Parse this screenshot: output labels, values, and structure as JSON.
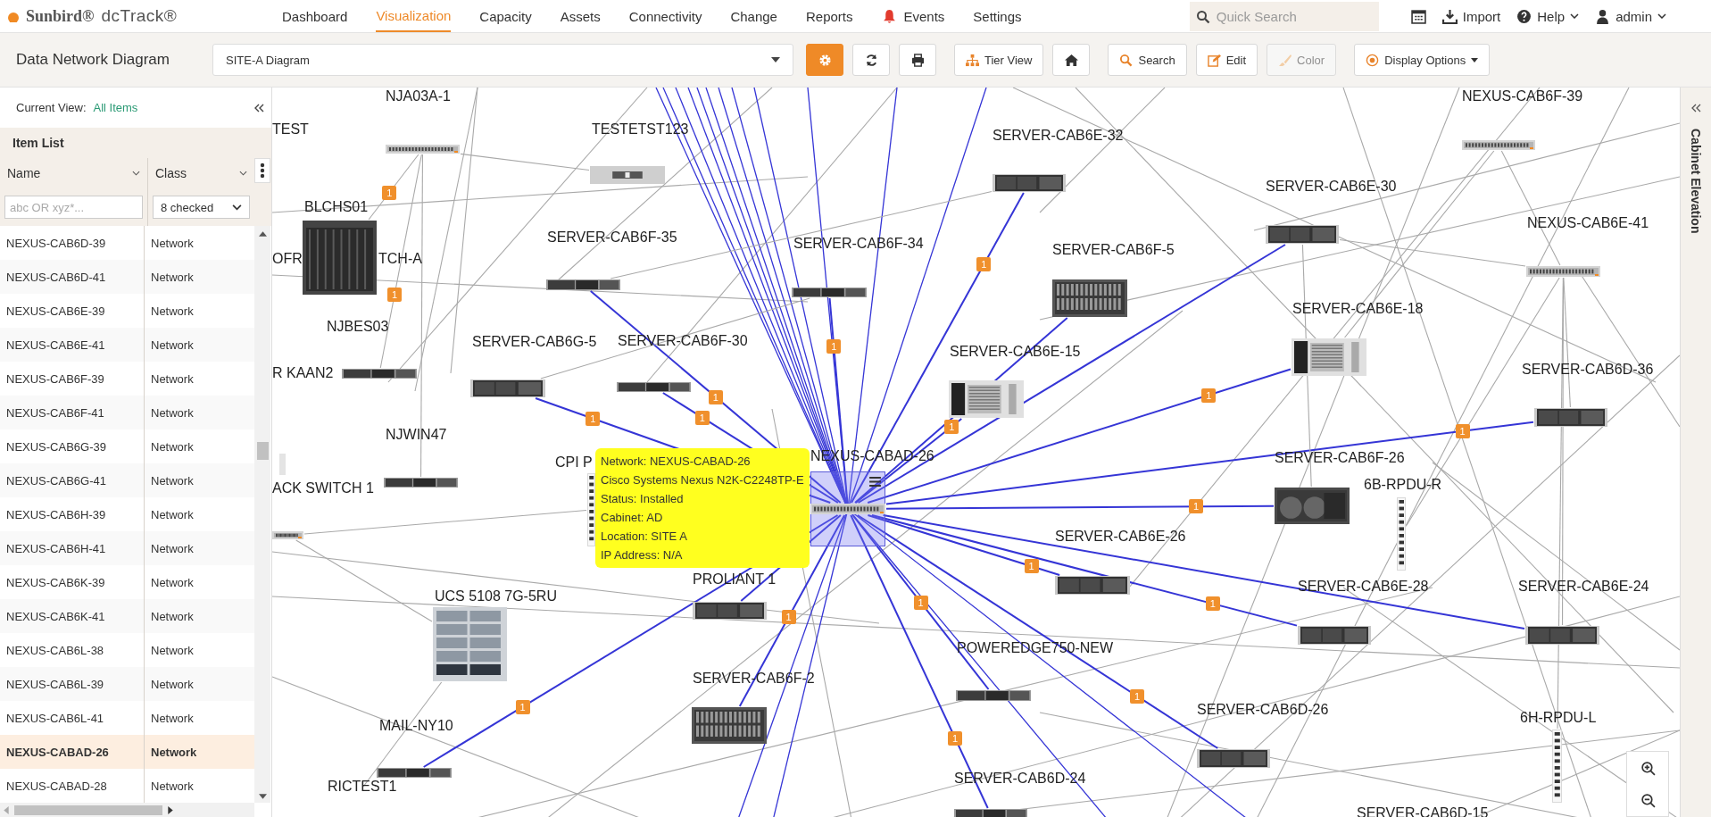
{
  "header": {
    "brand": "Sunbird®",
    "product": "dcTrack®",
    "nav": [
      {
        "label": "Dashboard",
        "kind": "plain",
        "selected": false
      },
      {
        "label": "Visualization",
        "kind": "plain",
        "selected": true
      },
      {
        "label": "Capacity",
        "kind": "plain",
        "selected": false
      },
      {
        "label": "Assets",
        "kind": "plain",
        "selected": false
      },
      {
        "label": "Connectivity",
        "kind": "plain",
        "selected": false
      },
      {
        "label": "Change",
        "kind": "plain",
        "selected": false
      },
      {
        "label": "Reports",
        "kind": "plain",
        "selected": false
      },
      {
        "label": "Events",
        "kind": "alert",
        "selected": false
      },
      {
        "label": "Settings",
        "kind": "plain",
        "selected": false
      }
    ],
    "search": {
      "placeholder": "Quick Search"
    },
    "actions": [
      {
        "kind": "calendar"
      },
      {
        "kind": "import",
        "label": "Import"
      },
      {
        "kind": "help",
        "label": "Help",
        "menu": true
      },
      {
        "kind": "user",
        "label": "admin",
        "menu": true
      }
    ]
  },
  "toolbar": {
    "title": "Data Network Diagram",
    "diagram_select": "SITE-A Diagram",
    "buttons": [
      {
        "kind": "settings",
        "active": true,
        "disabled": false
      },
      {
        "kind": "refresh",
        "active": false,
        "disabled": false
      },
      {
        "kind": "print",
        "active": false,
        "disabled": false
      },
      {
        "kind": "tier",
        "label": "Tier View",
        "active": false,
        "disabled": false
      },
      {
        "kind": "home",
        "active": false,
        "disabled": false
      },
      {
        "kind": "search",
        "label": "Search",
        "active": false,
        "disabled": false
      },
      {
        "kind": "edit",
        "label": "Edit",
        "active": false,
        "disabled": false
      },
      {
        "kind": "color",
        "label": "Color",
        "active": false,
        "disabled": true
      },
      {
        "kind": "display",
        "label": "Display Options",
        "menu": true,
        "active": false,
        "disabled": false
      }
    ]
  },
  "item_panel": {
    "current_view_label": "Current View:",
    "current_view": "All Items",
    "title": "Item List",
    "columns": [
      "Name",
      "Class"
    ],
    "name_filter_placeholder": "abc OR xyz*...",
    "class_filter": "8 checked",
    "rows": [
      {
        "name": "NEXUS-CAB6D-39",
        "class": "Network",
        "selected": false
      },
      {
        "name": "NEXUS-CAB6D-41",
        "class": "Network",
        "selected": false
      },
      {
        "name": "NEXUS-CAB6E-39",
        "class": "Network",
        "selected": false
      },
      {
        "name": "NEXUS-CAB6E-41",
        "class": "Network",
        "selected": false
      },
      {
        "name": "NEXUS-CAB6F-39",
        "class": "Network",
        "selected": false
      },
      {
        "name": "NEXUS-CAB6F-41",
        "class": "Network",
        "selected": false
      },
      {
        "name": "NEXUS-CAB6G-39",
        "class": "Network",
        "selected": false
      },
      {
        "name": "NEXUS-CAB6G-41",
        "class": "Network",
        "selected": false
      },
      {
        "name": "NEXUS-CAB6H-39",
        "class": "Network",
        "selected": false
      },
      {
        "name": "NEXUS-CAB6H-41",
        "class": "Network",
        "selected": false
      },
      {
        "name": "NEXUS-CAB6K-39",
        "class": "Network",
        "selected": false
      },
      {
        "name": "NEXUS-CAB6K-41",
        "class": "Network",
        "selected": false
      },
      {
        "name": "NEXUS-CAB6L-38",
        "class": "Network",
        "selected": false
      },
      {
        "name": "NEXUS-CAB6L-39",
        "class": "Network",
        "selected": false
      },
      {
        "name": "NEXUS-CAB6L-41",
        "class": "Network",
        "selected": false
      },
      {
        "name": "NEXUS-CABAD-26",
        "class": "Network",
        "selected": true
      },
      {
        "name": "NEXUS-CABAD-28",
        "class": "Network",
        "selected": false
      }
    ]
  },
  "diagram": {
    "nodes": [
      {
        "label": "NJA03A-1",
        "kind": "switch",
        "selected": false
      },
      {
        "label": "TEST",
        "kind": "label",
        "selected": false
      },
      {
        "label": "TESTETST123",
        "kind": "server-light",
        "selected": false
      },
      {
        "label": "BLCHS01",
        "kind": "chassis",
        "selected": false
      },
      {
        "label": "OFR",
        "kind": "label",
        "selected": false
      },
      {
        "label": "TCH-A",
        "kind": "label",
        "selected": false
      },
      {
        "label": "SERVER-CAB6F-35",
        "kind": "server1u",
        "selected": false
      },
      {
        "label": "SERVER-CAB6F-34",
        "kind": "server1u",
        "selected": false
      },
      {
        "label": "NJBES03",
        "kind": "label",
        "selected": false
      },
      {
        "label": "SERVER-CAB6G-5",
        "kind": "server2u",
        "selected": false
      },
      {
        "label": "SERVER-CAB6F-30",
        "kind": "server1u",
        "selected": false
      },
      {
        "label": "R KAAN2",
        "kind": "server1u",
        "selected": false
      },
      {
        "label": "NJWIN47",
        "kind": "server1u",
        "selected": false
      },
      {
        "label": "CPI P",
        "kind": "pdu",
        "selected": false
      },
      {
        "label": "ACK SWITCH 1",
        "kind": "switch",
        "selected": false
      },
      {
        "label": "NEXUS-CABAD-26",
        "kind": "switch",
        "selected": true
      },
      {
        "label": "PROLIANT 1",
        "kind": "server2u",
        "selected": false
      },
      {
        "label": "UCS 5108 7G-5RU",
        "kind": "ucs",
        "selected": false
      },
      {
        "label": "SERVER-CAB6F-2",
        "kind": "blade",
        "selected": false
      },
      {
        "label": "MAIL-NY10",
        "kind": "server1u",
        "selected": false
      },
      {
        "label": "RICTEST1",
        "kind": "label",
        "selected": false
      },
      {
        "label": "NEXUS-CAB6F-39",
        "kind": "switch",
        "selected": false
      },
      {
        "label": "SERVER-CAB6E-32",
        "kind": "server2u",
        "selected": false
      },
      {
        "label": "SERVER-CAB6E-30",
        "kind": "server2u",
        "selected": false
      },
      {
        "label": "NEXUS-CAB6E-41",
        "kind": "switch",
        "selected": false
      },
      {
        "label": "SERVER-CAB6F-5",
        "kind": "blade",
        "selected": false
      },
      {
        "label": "SERVER-CAB6E-18",
        "kind": "tower",
        "selected": false
      },
      {
        "label": "SERVER-CAB6E-15",
        "kind": "tower",
        "selected": false
      },
      {
        "label": "SERVER-CAB6D-36",
        "kind": "server2u",
        "selected": false
      },
      {
        "label": "SERVER-CAB6F-26",
        "kind": "fan",
        "selected": false
      },
      {
        "label": "6B-RPDU-R",
        "kind": "pdu",
        "selected": false
      },
      {
        "label": "SERVER-CAB6E-26",
        "kind": "server2u",
        "selected": false
      },
      {
        "label": "SERVER-CAB6E-28",
        "kind": "server2u",
        "selected": false
      },
      {
        "label": "SERVER-CAB6E-24",
        "kind": "server2u",
        "selected": false
      },
      {
        "label": "POWEREDGE750-NEW",
        "kind": "server1u",
        "selected": false
      },
      {
        "label": "SERVER-CAB6D-26",
        "kind": "server2u",
        "selected": false
      },
      {
        "label": "6H-RPDU-L",
        "kind": "pdu",
        "selected": false
      },
      {
        "label": "SERVER-CAB6D-24",
        "kind": "server1u",
        "selected": false
      },
      {
        "label": "SERVER-CAB6D-15",
        "kind": "label",
        "selected": false
      }
    ],
    "links": [
      {
        "highlighted": true,
        "badge": "1"
      },
      {
        "highlighted": true,
        "badge": "1"
      },
      {
        "highlighted": true,
        "badge": "1"
      },
      {
        "highlighted": true,
        "badge": "1"
      },
      {
        "highlighted": true
      },
      {
        "highlighted": true,
        "badge": "1"
      },
      {
        "highlighted": true,
        "badge": "1"
      },
      {
        "highlighted": true,
        "badge": "1"
      },
      {
        "highlighted": true
      },
      {
        "highlighted": true
      },
      {
        "highlighted": true,
        "badge": "1"
      },
      {
        "highlighted": true,
        "badge": "1"
      },
      {
        "highlighted": true,
        "badge": "1"
      },
      {
        "highlighted": true,
        "badge": "1"
      },
      {
        "highlighted": true,
        "badge": "1"
      },
      {
        "highlighted": true,
        "badge": "1"
      },
      {
        "highlighted": true
      },
      {
        "highlighted": true,
        "badge": "1"
      },
      {
        "highlighted": true,
        "badge": "1"
      },
      {
        "highlighted": true,
        "badge": "1"
      },
      {
        "highlighted": false,
        "badge": "1"
      },
      {
        "highlighted": false
      },
      {
        "highlighted": false,
        "badge": "1"
      },
      {
        "highlighted": false
      },
      {
        "highlighted": false
      },
      {
        "highlighted": false
      },
      {
        "highlighted": false
      },
      {
        "highlighted": false
      },
      {
        "highlighted": false
      },
      {
        "highlighted": false
      },
      {
        "highlighted": false
      },
      {
        "highlighted": false
      },
      {
        "highlighted": false
      },
      {
        "highlighted": false
      },
      {
        "highlighted": false
      },
      {
        "highlighted": false
      },
      {
        "highlighted": false
      }
    ],
    "tooltip": {
      "lines": [
        "Network: NEXUS-CABAD-26",
        "Cisco Systems Nexus N2K-C2248TP-E",
        "Status: Installed",
        "Cabinet: AD",
        "Location: SITE A",
        "IP Address: N/A"
      ]
    }
  },
  "side_panel": {
    "title": "Cabinet Elevation"
  }
}
